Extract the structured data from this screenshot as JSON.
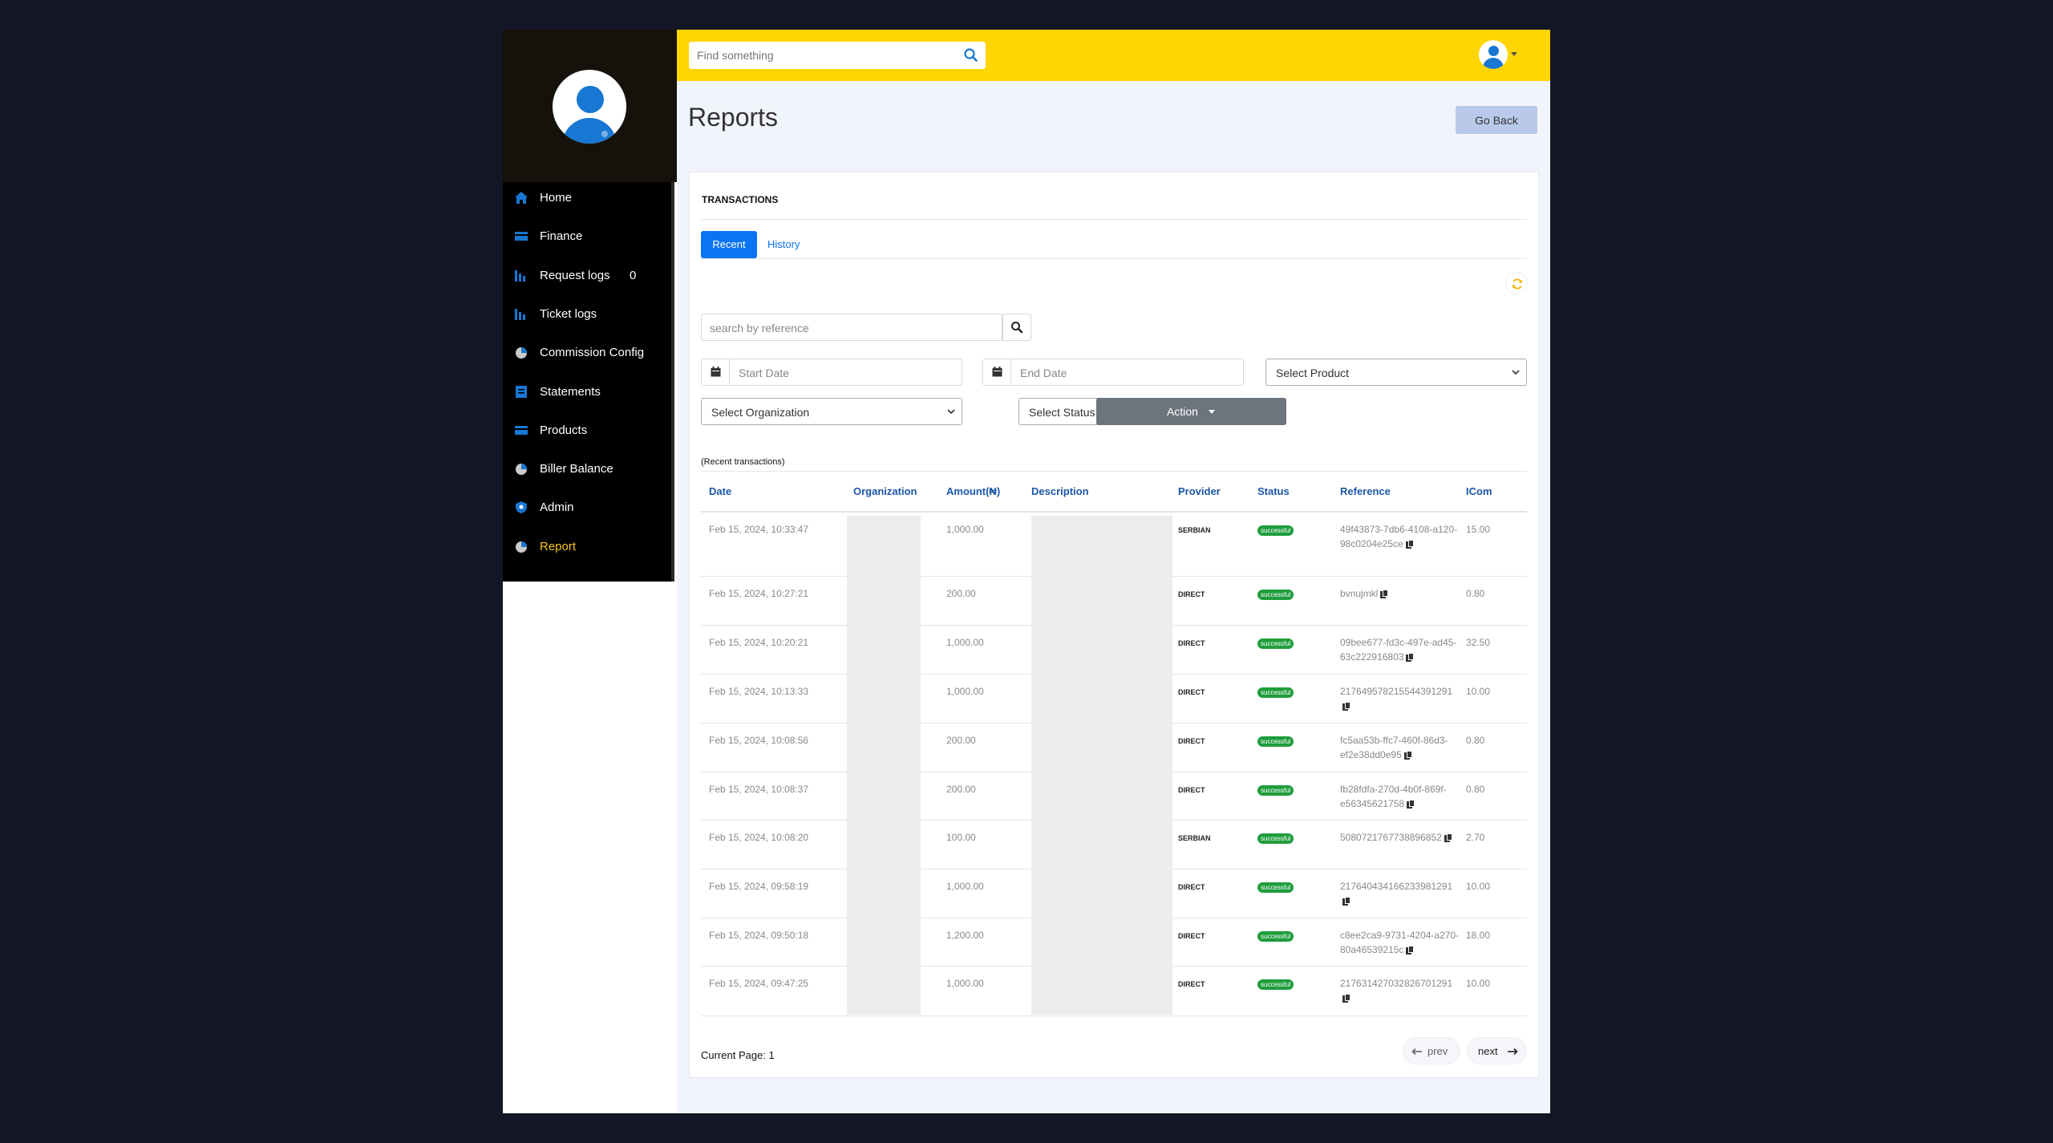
{
  "search": {
    "placeholder": "Find something"
  },
  "sidebar": {
    "items": [
      {
        "label": "Home",
        "icon": "home-icon"
      },
      {
        "label": "Finance",
        "icon": "card-icon"
      },
      {
        "label": "Request logs",
        "icon": "bar-chart-icon",
        "badge": "0"
      },
      {
        "label": "Ticket logs",
        "icon": "bar-chart-icon"
      },
      {
        "label": "Commission Config",
        "icon": "pie-chart-icon"
      },
      {
        "label": "Statements",
        "icon": "document-icon"
      },
      {
        "label": "Products",
        "icon": "card-icon"
      },
      {
        "label": "Biller Balance",
        "icon": "pie-chart-icon"
      },
      {
        "label": "Admin",
        "icon": "shield-icon"
      },
      {
        "label": "Report",
        "icon": "pie-chart-icon",
        "active": true
      }
    ]
  },
  "page": {
    "title": "Reports",
    "go_back": "Go Back"
  },
  "card": {
    "header": "TRANSACTIONS",
    "tabs": {
      "recent": "Recent",
      "history": "History"
    },
    "ref_search_placeholder": "search by reference",
    "start_date_placeholder": "Start Date",
    "end_date_placeholder": "End Date",
    "select_product": "Select Product",
    "select_organization": "Select Organization",
    "select_status": "Select Status",
    "action": "Action",
    "caption": "(Recent transactions)"
  },
  "table": {
    "columns": [
      "Date",
      "Organization",
      "Amount(₦)",
      "Description",
      "Provider",
      "Status",
      "Reference",
      "ICom"
    ],
    "rows": [
      {
        "date": "Feb 15, 2024, 10:33:47",
        "amount": "1,000.00",
        "provider": "SERBIAN",
        "status": "successful",
        "reference": "49f43873-7db6-4108-a120-98c0204e25ce",
        "icom": "15.00"
      },
      {
        "date": "Feb 15, 2024, 10:27:21",
        "amount": "200.00",
        "provider": "DIRECT",
        "status": "successful",
        "reference": "bvnujmkl",
        "icom": "0.80"
      },
      {
        "date": "Feb 15, 2024, 10:20:21",
        "amount": "1,000.00",
        "provider": "DIRECT",
        "status": "successful",
        "reference": "09bee677-fd3c-497e-ad45-63c222916803",
        "icom": "32.50"
      },
      {
        "date": "Feb 15, 2024, 10:13:33",
        "amount": "1,000.00",
        "provider": "DIRECT",
        "status": "successful",
        "reference": "2176495782155443912​91",
        "icom": "10.00"
      },
      {
        "date": "Feb 15, 2024, 10:08:56",
        "amount": "200.00",
        "provider": "DIRECT",
        "status": "successful",
        "reference": "fc5aa53b-ffc7-460f-86d3-ef2e38dd0e95",
        "icom": "0.80"
      },
      {
        "date": "Feb 15, 2024, 10:08:37",
        "amount": "200.00",
        "provider": "DIRECT",
        "status": "successful",
        "reference": "fb28fdfa-270d-4b0f-869f-e56345621758",
        "icom": "0.80"
      },
      {
        "date": "Feb 15, 2024, 10:08:20",
        "amount": "100.00",
        "provider": "SERBIAN",
        "status": "successful",
        "reference": "508072176773889685​2",
        "icom": "2.70"
      },
      {
        "date": "Feb 15, 2024, 09:58:19",
        "amount": "1,000.00",
        "provider": "DIRECT",
        "status": "successful",
        "reference": "2176404341662339812​91",
        "icom": "10.00"
      },
      {
        "date": "Feb 15, 2024, 09:50:18",
        "amount": "1,200.00",
        "provider": "DIRECT",
        "status": "successful",
        "reference": "c8ee2ca9-9731-4204-a270-80a46539215c",
        "icom": "18.00"
      },
      {
        "date": "Feb 15, 2024, 09:47:25",
        "amount": "1,000.00",
        "provider": "DIRECT",
        "status": "successful",
        "reference": "2176314270328267012​91",
        "icom": "10.00"
      }
    ]
  },
  "pagination": {
    "current": "Current Page: 1",
    "prev": "prev",
    "next": "next"
  },
  "colors": {
    "topbar": "#ffd503",
    "sidebar": "#000000",
    "primary": "#0b74f5",
    "success": "#1f9d3c",
    "active_nav": "#f5c518"
  }
}
